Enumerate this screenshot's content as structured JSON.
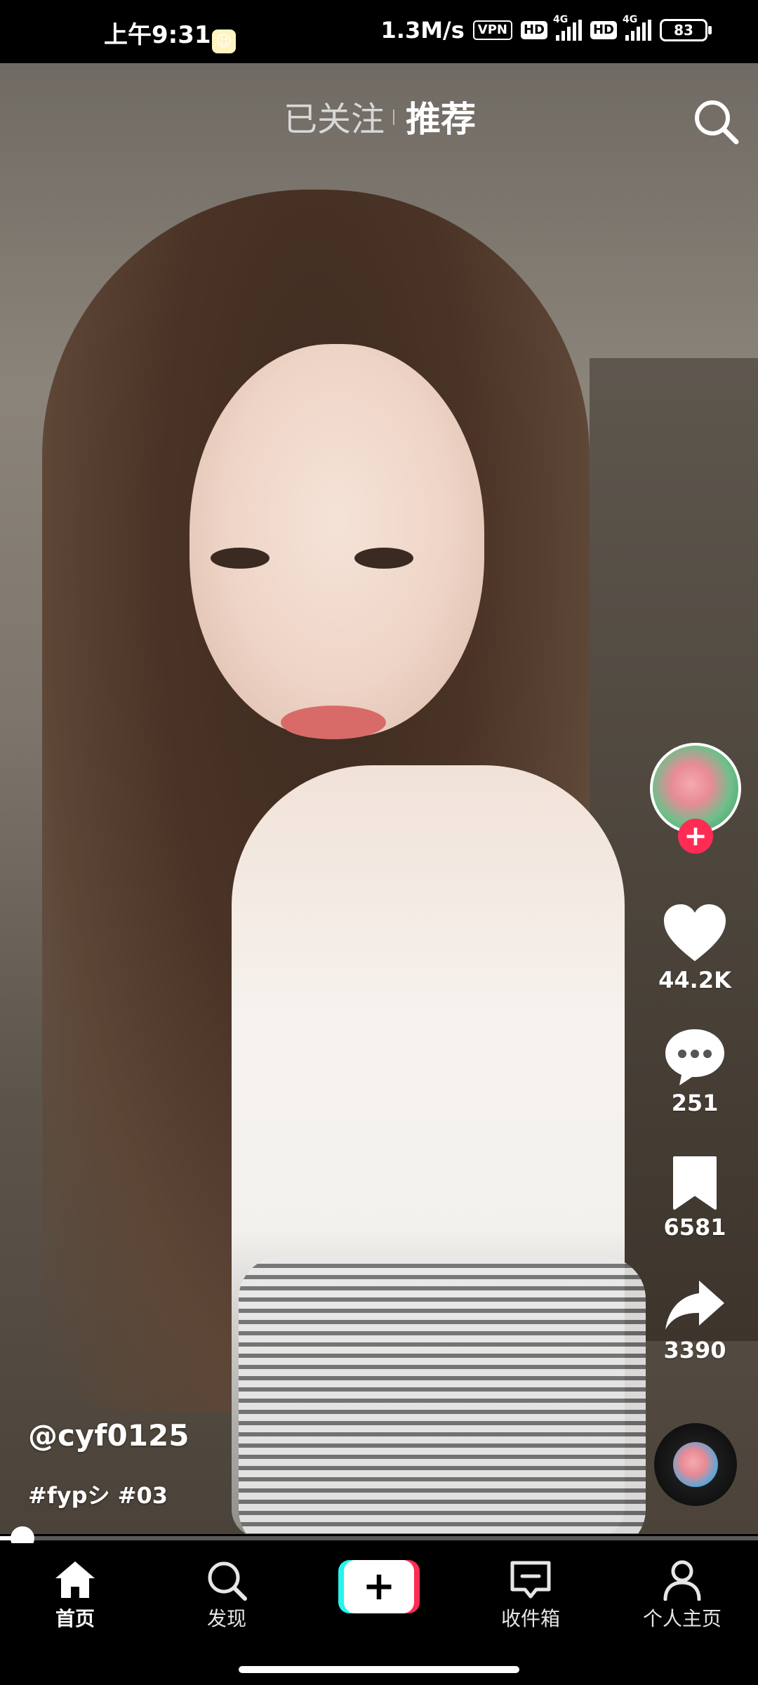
{
  "status_bar": {
    "time": "上午9:31",
    "net_speed": "1.3M/s",
    "vpn": "VPN",
    "hd1": "HD",
    "net1": "4G",
    "hd2": "HD",
    "net2": "4G",
    "battery": "83"
  },
  "top_tabs": {
    "following": "已关注",
    "recommend": "推荐",
    "active": "recommend"
  },
  "video": {
    "author": "@cyf0125",
    "caption": "#fypシ #03",
    "progress": 0.03
  },
  "actions": {
    "likes": "44.2K",
    "comments": "251",
    "favorites": "6581",
    "shares": "3390",
    "follow_label": "+"
  },
  "bottom_nav": {
    "home": "首页",
    "discover": "发现",
    "create": "+",
    "inbox": "收件箱",
    "profile": "个人主页",
    "active": "home"
  },
  "colors": {
    "accent": "#fe2c55",
    "accent_cyan": "#25f4ee",
    "background": "#000000"
  }
}
